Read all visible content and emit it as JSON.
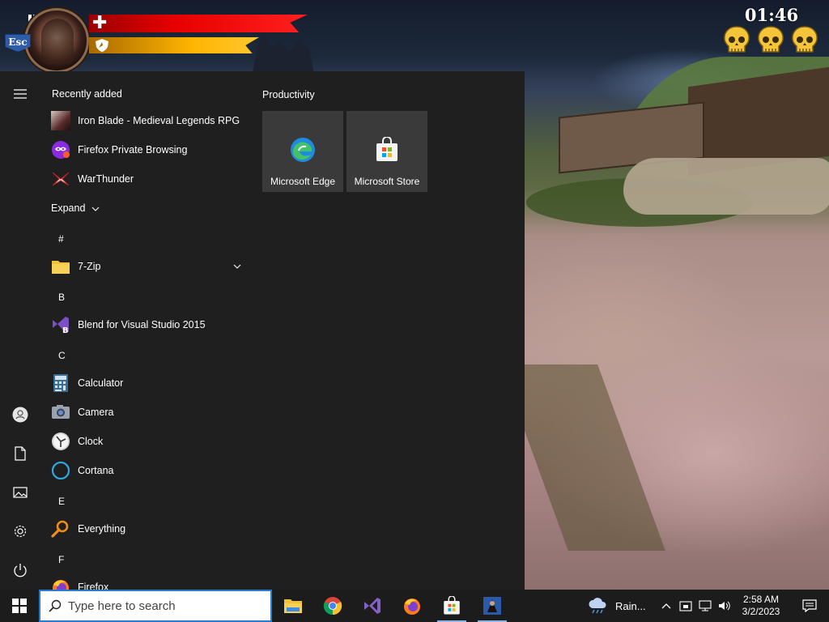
{
  "game": {
    "timer": "01:46",
    "esc_label": "Esc",
    "skull_count": 3,
    "health_fraction": 1.0,
    "stamina_fraction": 1.0
  },
  "start_menu": {
    "recently_added_title": "Recently added",
    "recent": [
      {
        "label": "Iron Blade - Medieval Legends RPG",
        "icon": "iron-blade-icon"
      },
      {
        "label": "Firefox Private Browsing",
        "icon": "firefox-private-icon"
      },
      {
        "label": "WarThunder",
        "icon": "warthunder-icon"
      }
    ],
    "expand_label": "Expand",
    "groups": [
      {
        "letter": "#",
        "apps": [
          {
            "label": "7-Zip",
            "icon": "folder-icon",
            "expandable": true
          }
        ]
      },
      {
        "letter": "B",
        "apps": [
          {
            "label": "Blend for Visual Studio 2015",
            "icon": "blend-icon"
          }
        ]
      },
      {
        "letter": "C",
        "apps": [
          {
            "label": "Calculator",
            "icon": "calculator-icon"
          },
          {
            "label": "Camera",
            "icon": "camera-icon"
          },
          {
            "label": "Clock",
            "icon": "clock-icon"
          },
          {
            "label": "Cortana",
            "icon": "cortana-icon"
          }
        ]
      },
      {
        "letter": "E",
        "apps": [
          {
            "label": "Everything",
            "icon": "everything-search-icon"
          }
        ]
      },
      {
        "letter": "F",
        "apps": [
          {
            "label": "Firefox",
            "icon": "firefox-icon"
          }
        ]
      }
    ],
    "tiles_group_title": "Productivity",
    "tiles": [
      {
        "label": "Microsoft Edge",
        "icon": "edge-icon"
      },
      {
        "label": "Microsoft Store",
        "icon": "store-icon"
      }
    ]
  },
  "taskbar": {
    "search_placeholder": "Type here to search",
    "weather_text": "Rain...",
    "time": "2:58 AM",
    "date": "3/2/2023",
    "pinned": [
      "file-explorer-icon",
      "chrome-icon",
      "visual-studio-icon",
      "firefox-icon",
      "store-icon",
      "iron-blade-icon"
    ]
  }
}
